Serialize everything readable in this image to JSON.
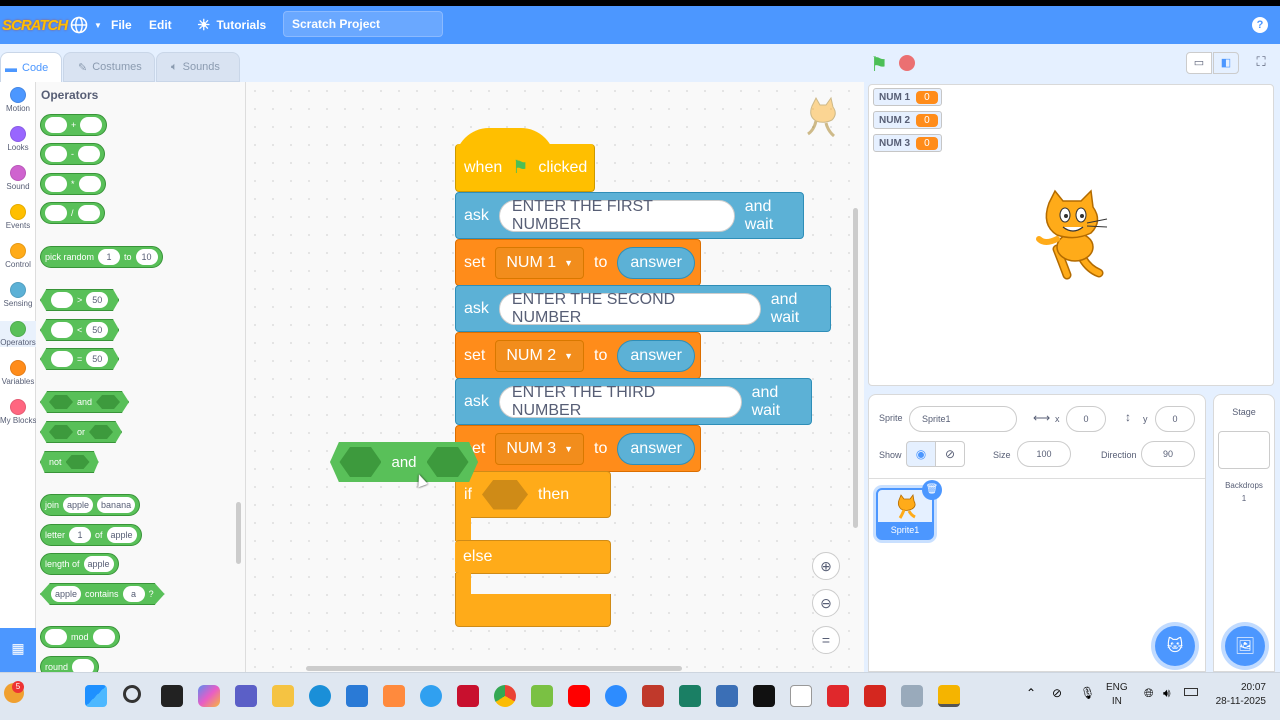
{
  "menubar": {
    "logo": "SCRATCH",
    "file": "File",
    "edit": "Edit",
    "tutorials": "Tutorials",
    "project_title": "Scratch Project",
    "help": "?"
  },
  "tabs": {
    "code": "Code",
    "costumes": "Costumes",
    "sounds": "Sounds"
  },
  "categories": [
    {
      "label": "Motion",
      "color": "#4c97ff"
    },
    {
      "label": "Looks",
      "color": "#9966ff"
    },
    {
      "label": "Sound",
      "color": "#cf63cf"
    },
    {
      "label": "Events",
      "color": "#ffbf00"
    },
    {
      "label": "Control",
      "color": "#ffab19"
    },
    {
      "label": "Sensing",
      "color": "#5cb1d6"
    },
    {
      "label": "Operators",
      "color": "#59c059"
    },
    {
      "label": "Variables",
      "color": "#ff8c1a"
    },
    {
      "label": "My Blocks",
      "color": "#ff6680"
    }
  ],
  "palette": {
    "title": "Operators",
    "ops": [
      "+",
      "-",
      "*",
      "/"
    ],
    "pick_random": {
      "label": "pick random",
      "from": "1",
      "to_label": "to",
      "to": "10"
    },
    "gt": {
      "op": ">",
      "value": "50"
    },
    "lt": {
      "op": "<",
      "value": "50"
    },
    "eq": {
      "op": "=",
      "value": "50"
    },
    "and": "and",
    "or": "or",
    "not": "not",
    "join": {
      "label": "join",
      "a": "apple",
      "b": "banana"
    },
    "letter": {
      "label": "letter",
      "n": "1",
      "of": "of",
      "word": "apple"
    },
    "length": {
      "label": "length of",
      "word": "apple"
    },
    "contains": {
      "a": "apple",
      "label": "contains",
      "b": "a",
      "q": "?"
    },
    "mod": "mod",
    "round": "round"
  },
  "script": {
    "hat_when": "when",
    "hat_clicked": "clicked",
    "ask_label": "ask",
    "and_wait": "and wait",
    "set_label": "set",
    "to_label": "to",
    "answer": "answer",
    "q1": "ENTER THE FIRST NUMBER",
    "q2": "ENTER THE SECOND NUMBER",
    "q3": "ENTER THE THIRD NUMBER",
    "v1": "NUM 1",
    "v2": "NUM 2",
    "v3": "NUM 3",
    "if_label": "if",
    "then_label": "then",
    "else_label": "else"
  },
  "dragged_block": "and",
  "monitors": [
    {
      "name": "NUM 1",
      "value": "0"
    },
    {
      "name": "NUM 2",
      "value": "0"
    },
    {
      "name": "NUM 3",
      "value": "0"
    }
  ],
  "sprite_info": {
    "sprite_label": "Sprite",
    "sprite_name": "Sprite1",
    "x_label": "x",
    "x": "0",
    "y_label": "y",
    "y": "0",
    "show_label": "Show",
    "size_label": "Size",
    "size": "100",
    "direction_label": "Direction",
    "direction": "90"
  },
  "sprite_thumb": "Sprite1",
  "stage_pane": {
    "title": "Stage",
    "backdrops_label": "Backdrops",
    "backdrops_count": "1"
  },
  "taskbar": {
    "lang1": "ENG",
    "lang2": "IN",
    "time": "20:07",
    "date": "28-11-2025",
    "badge": "5"
  }
}
